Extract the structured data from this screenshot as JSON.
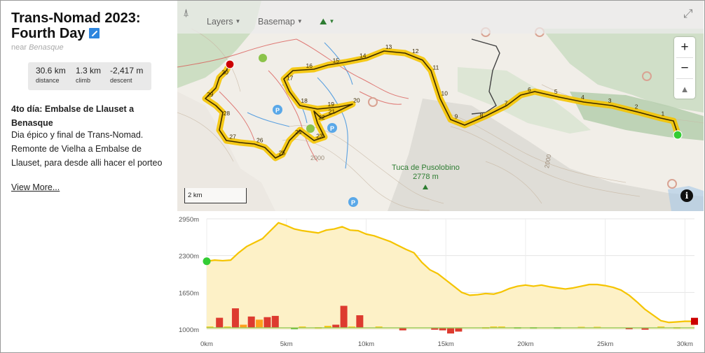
{
  "route": {
    "title": "Trans-Nomad 2023: Fourth Day",
    "near_prefix": "near",
    "near_place": "Benasque",
    "stats": [
      {
        "value": "30.6 km",
        "label": "distance"
      },
      {
        "value": "1.3 km",
        "label": "climb"
      },
      {
        "value": "-2,417 m",
        "label": "descent"
      }
    ],
    "description_title": "4to día: Embalse de Llauset a Benasque",
    "description": "Dia épico y final de Trans-Nomad. Remonte de Vielha a Embalse de Llauset, para desde alli hacer el porteo",
    "view_more": "View More..."
  },
  "map": {
    "toolbar": {
      "layers": "Layers",
      "basemap": "Basemap"
    },
    "zoom_in": "+",
    "zoom_out": "−",
    "scale_label": "2 km",
    "peak": {
      "name": "Tuca de Pusolobino",
      "elevation": "2778 m"
    },
    "contour_label": "2000",
    "contour_label_2": "2000",
    "km_markers": [
      "1",
      "2",
      "3",
      "4",
      "5",
      "6",
      "7",
      "8",
      "9",
      "10",
      "11",
      "12",
      "13",
      "14",
      "15",
      "16",
      "17",
      "18",
      "19",
      "20",
      "21",
      "22",
      "23",
      "24",
      "25",
      "26",
      "27",
      "28",
      "29",
      "30"
    ],
    "route_color": "#f5c400",
    "track_color": "#3b2a00",
    "start_color": "#33cc33",
    "end_color": "#cc0000"
  },
  "chart_data": {
    "type": "area",
    "title": "",
    "xlabel": "",
    "ylabel": "",
    "x_unit": "km",
    "y_unit": "m",
    "xlim": [
      0,
      30.6
    ],
    "ylim": [
      1000,
      2950
    ],
    "yticks": [
      "2950m",
      "2300m",
      "1650m",
      "1000m"
    ],
    "xticks": [
      "0km",
      "5km",
      "10km",
      "15km",
      "20km",
      "25km",
      "30km"
    ],
    "series": [
      {
        "x": [
          0,
          0.5,
          1,
          1.5,
          2,
          2.5,
          3,
          3.5,
          4,
          4.5,
          5,
          5.5,
          6,
          6.5,
          7,
          7.5,
          8,
          8.5,
          9,
          9.5,
          10,
          10.5,
          11,
          11.5,
          12,
          12.5,
          13,
          13.5,
          14,
          14.5,
          15,
          15.5,
          16,
          16.5,
          17,
          17.5,
          18,
          18.5,
          19,
          19.5,
          20,
          20.5,
          21,
          21.5,
          22,
          22.5,
          23,
          23.5,
          24,
          24.5,
          25,
          25.5,
          26,
          26.5,
          27,
          27.5,
          28,
          28.5,
          29,
          29.5,
          30,
          30.6
        ],
        "y": [
          2200,
          2220,
          2210,
          2220,
          2350,
          2460,
          2530,
          2600,
          2740,
          2880,
          2830,
          2770,
          2740,
          2720,
          2700,
          2750,
          2770,
          2810,
          2750,
          2740,
          2680,
          2650,
          2600,
          2550,
          2480,
          2410,
          2350,
          2180,
          2050,
          1980,
          1870,
          1760,
          1650,
          1600,
          1610,
          1630,
          1620,
          1660,
          1720,
          1760,
          1780,
          1760,
          1780,
          1750,
          1730,
          1710,
          1730,
          1760,
          1790,
          1790,
          1770,
          1740,
          1690,
          1600,
          1480,
          1350,
          1250,
          1150,
          1120,
          1130,
          1140,
          1140
        ]
      }
    ],
    "grade_bars": [
      {
        "x": 0.2,
        "v": 0.1,
        "c": "#f5c400"
      },
      {
        "x": 0.8,
        "v": 0.8,
        "c": "#dd3b2f"
      },
      {
        "x": 1.3,
        "v": 0.1,
        "c": "#f5c400"
      },
      {
        "x": 1.8,
        "v": 1.55,
        "c": "#dd3b2f"
      },
      {
        "x": 2.3,
        "v": 0.25,
        "c": "#ff9f1c"
      },
      {
        "x": 2.8,
        "v": 0.9,
        "c": "#dd3b2f"
      },
      {
        "x": 3.3,
        "v": 0.65,
        "c": "#ff9f1c"
      },
      {
        "x": 3.8,
        "v": 0.85,
        "c": "#dd3b2f"
      },
      {
        "x": 4.3,
        "v": 0.95,
        "c": "#dd3b2f"
      },
      {
        "x": 5.5,
        "v": -0.1,
        "c": "#66bb33"
      },
      {
        "x": 6.0,
        "v": 0.1,
        "c": "#f5c400"
      },
      {
        "x": 7.0,
        "v": 0.05,
        "c": "#f5c400"
      },
      {
        "x": 7.6,
        "v": 0.15,
        "c": "#f5c400"
      },
      {
        "x": 8.1,
        "v": 0.25,
        "c": "#dd3b2f"
      },
      {
        "x": 8.6,
        "v": 1.75,
        "c": "#dd3b2f"
      },
      {
        "x": 9.1,
        "v": 0.1,
        "c": "#f5c400"
      },
      {
        "x": 9.6,
        "v": 1.0,
        "c": "#dd3b2f"
      },
      {
        "x": 10.8,
        "v": 0.1,
        "c": "#f5c400"
      },
      {
        "x": 12.3,
        "v": -0.2,
        "c": "#dd3b2f"
      },
      {
        "x": 14.3,
        "v": -0.15,
        "c": "#dd3b2f"
      },
      {
        "x": 14.8,
        "v": -0.2,
        "c": "#dd3b2f"
      },
      {
        "x": 15.3,
        "v": -0.45,
        "c": "#dd3b2f"
      },
      {
        "x": 15.8,
        "v": -0.3,
        "c": "#dd3b2f"
      },
      {
        "x": 17.5,
        "v": 0.05,
        "c": "#f5c400"
      },
      {
        "x": 18.0,
        "v": 0.1,
        "c": "#f5c400"
      },
      {
        "x": 18.5,
        "v": 0.1,
        "c": "#f5c400"
      },
      {
        "x": 19.5,
        "v": 0.05,
        "c": "#66bb33"
      },
      {
        "x": 20.5,
        "v": 0.05,
        "c": "#66bb33"
      },
      {
        "x": 22.0,
        "v": 0.05,
        "c": "#66bb33"
      },
      {
        "x": 23.5,
        "v": 0.08,
        "c": "#f5c400"
      },
      {
        "x": 24.5,
        "v": 0.08,
        "c": "#f5c400"
      },
      {
        "x": 26.5,
        "v": -0.1,
        "c": "#dd3b2f"
      },
      {
        "x": 27.5,
        "v": -0.15,
        "c": "#dd3b2f"
      },
      {
        "x": 28.5,
        "v": 0.1,
        "c": "#f5c400"
      },
      {
        "x": 29.5,
        "v": 0.05,
        "c": "#f5c400"
      }
    ]
  }
}
